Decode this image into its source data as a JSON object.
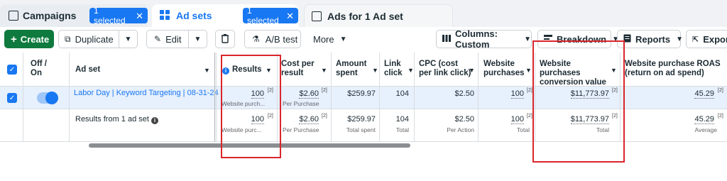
{
  "tabs": {
    "campaigns": {
      "label": "Campaigns"
    },
    "adsets": {
      "label": "Ad sets",
      "selected": "1 selected"
    },
    "campaigns_selected": "1 selected",
    "ads": {
      "label": "Ads for 1 Ad set"
    }
  },
  "toolbar": {
    "create": "Create",
    "duplicate": "Duplicate",
    "edit": "Edit",
    "ab_test": "A/B test",
    "more": "More",
    "columns": "Columns: Custom",
    "breakdown": "Breakdown",
    "reports": "Reports",
    "export": "Export"
  },
  "table": {
    "headers": {
      "off_on": "Off / On",
      "ad_set": "Ad set",
      "results": "Results",
      "cost_per_result": "Cost per result",
      "amount_spent": "Amount spent",
      "link_click": "Link click",
      "cpc": "CPC (cost per link click)",
      "website_purchases": "Website purchases",
      "website_purchases_value": "Website purchases conversion value",
      "website_purchase_roas": "Website purchase ROAS (return on ad spend)"
    },
    "row": {
      "name": "Labor Day | Keyword Targeting | 08-31-24",
      "results": "100",
      "results_sub": "Website purch...",
      "cost_per_result": "$2.60",
      "cost_per_result_sub": "Per Purchase",
      "amount_spent": "$259.97",
      "link_click": "104",
      "cpc": "$2.50",
      "website_purchases": "100",
      "conversion_value": "$11,773.97",
      "roas": "45.29"
    },
    "summary": {
      "label": "Results from 1 ad set",
      "results": "100",
      "results_sub": "Website purc...",
      "cost_per_result": "$2.60",
      "cost_per_result_sub": "Per Purchase",
      "amount_spent": "$259.97",
      "amount_spent_sub": "Total spent",
      "link_click": "104",
      "link_click_sub": "Total",
      "cpc": "$2.50",
      "cpc_sub": "Per Action",
      "website_purchases": "100",
      "website_purchases_sub": "Total",
      "conversion_value": "$11,773.97",
      "conversion_value_sub": "Total",
      "roas": "45.29",
      "roas_sub": "Average"
    },
    "footnote_marker": "[2]"
  },
  "colors": {
    "accent": "#1877f2",
    "create_green": "#0f7a3e",
    "highlight_red": "#d9262c",
    "selected_row": "#e7f0fd"
  }
}
